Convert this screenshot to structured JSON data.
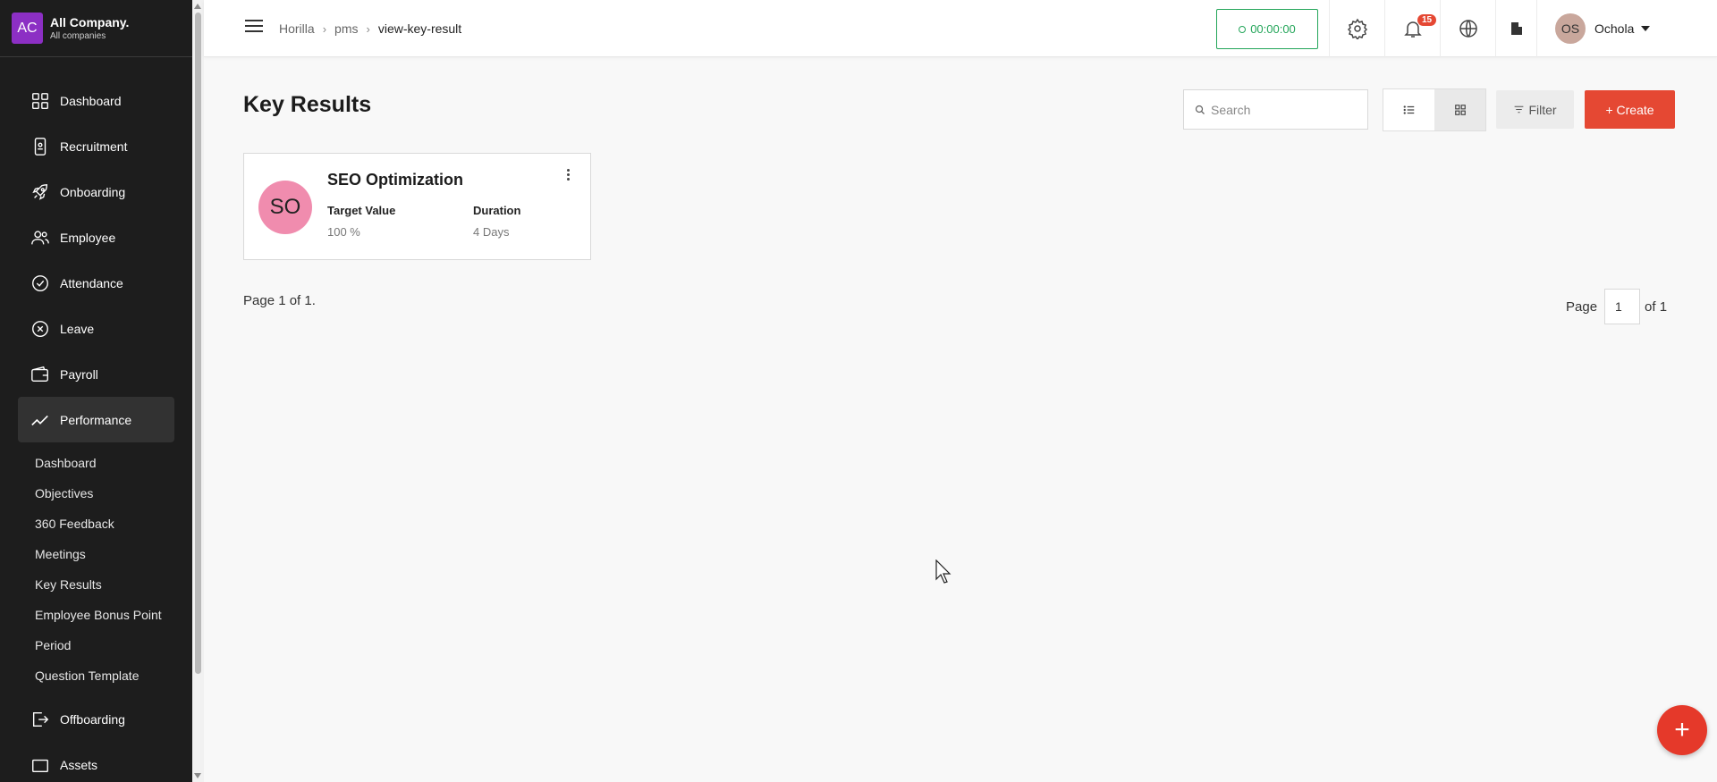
{
  "company": {
    "logo": "AC",
    "name": "All Company.",
    "subtitle": "All companies"
  },
  "sidebar": {
    "items": [
      {
        "label": "Dashboard",
        "icon": "dashboard-icon"
      },
      {
        "label": "Recruitment",
        "icon": "recruitment-icon"
      },
      {
        "label": "Onboarding",
        "icon": "rocket-icon"
      },
      {
        "label": "Employee",
        "icon": "people-icon"
      },
      {
        "label": "Attendance",
        "icon": "check-circle-icon"
      },
      {
        "label": "Leave",
        "icon": "x-circle-icon"
      },
      {
        "label": "Payroll",
        "icon": "wallet-icon"
      },
      {
        "label": "Performance",
        "icon": "trend-icon",
        "active": true
      }
    ],
    "performance_sub": [
      "Dashboard",
      "Objectives",
      "360 Feedback",
      "Meetings",
      "Key Results",
      "Employee Bonus Point",
      "Period",
      "Question Template"
    ],
    "after_items": [
      {
        "label": "Offboarding",
        "icon": "exit-icon"
      },
      {
        "label": "Assets",
        "icon": "assets-icon"
      }
    ]
  },
  "topbar": {
    "breadcrumb": [
      "Horilla",
      "pms",
      "view-key-result"
    ],
    "timer": "00:00:00",
    "notifications_count": "15",
    "user_initials": "OS",
    "user_name": "Ochola"
  },
  "main": {
    "title": "Key Results",
    "search_placeholder": "Search",
    "filter_label": "Filter",
    "create_label": "+ Create",
    "card": {
      "initials": "SO",
      "title": "SEO Optimization",
      "target_label": "Target Value",
      "target_value": "100 %",
      "duration_label": "Duration",
      "duration_value": "4 Days"
    },
    "page_info": "Page 1 of 1.",
    "pager_label": "Page",
    "pager_value": "1",
    "pager_of": "of 1"
  },
  "colors": {
    "accent": "#e54833",
    "timer": "#23a559",
    "sidebar": "#1d1d1d",
    "avatar_pink": "#f08cae"
  }
}
